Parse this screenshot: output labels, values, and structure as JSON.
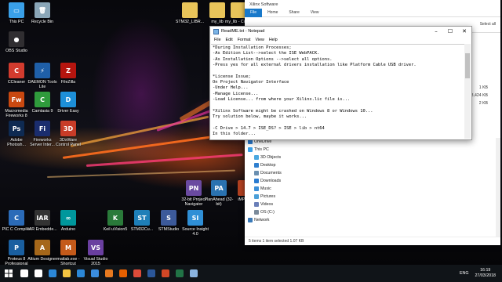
{
  "desktop_icons": [
    {
      "label": "This PC",
      "icon": "this-pc-icon",
      "color": "#3aa0e8",
      "glyph": "▭"
    },
    {
      "label": "Recycle Bin",
      "icon": "recycle-bin-icon",
      "color": "#8aa6b8",
      "glyph": "🗑"
    },
    {
      "label": "OBS Studio",
      "icon": "obs-studio-icon",
      "color": "#302e31",
      "glyph": "●"
    },
    {
      "label": "CCleaner",
      "icon": "ccleaner-icon",
      "color": "#d23b2e",
      "glyph": "C"
    },
    {
      "label": "DAEMON Tools Lite",
      "icon": "daemon-tools-icon",
      "color": "#1f5fa8",
      "glyph": "⚡"
    },
    {
      "label": "FileZilla",
      "icon": "filezilla-icon",
      "color": "#b5150f",
      "glyph": "Z"
    },
    {
      "label": "Macromedia Fireworks 8",
      "icon": "fireworks-icon",
      "color": "#c94810",
      "glyph": "Fw"
    },
    {
      "label": "Camtasia 9",
      "icon": "camtasia-icon",
      "color": "#2f9b3c",
      "glyph": "C"
    },
    {
      "label": "Driver Easy",
      "icon": "driver-easy-icon",
      "color": "#1d8fd8",
      "glyph": "D"
    },
    {
      "label": "Adobe Photosh...",
      "icon": "photoshop-icon",
      "color": "#0e2a52",
      "glyph": "Ps"
    },
    {
      "label": "Fireworks Server Inter...",
      "icon": "fireworks-server-icon",
      "color": "#1a2d6e",
      "glyph": "Fi"
    },
    {
      "label": "3DxWare Control Panel",
      "icon": "3dxware-icon",
      "color": "#c83c28",
      "glyph": "3D"
    },
    {
      "label": "PIC C Compiler",
      "icon": "pic-c-compiler-icon",
      "color": "#2b6bb8",
      "glyph": "C"
    },
    {
      "label": "IAR Embedde...",
      "icon": "iar-embedded-icon",
      "color": "#333333",
      "glyph": "IAR"
    },
    {
      "label": "Arduino",
      "icon": "arduino-icon",
      "color": "#00979c",
      "glyph": "∞"
    },
    {
      "label": "Keil uVision5",
      "icon": "keil-uvision-icon",
      "color": "#2a7a3a",
      "glyph": "K"
    },
    {
      "label": "STM32Cu...",
      "icon": "stm32cube-icon",
      "color": "#1e7fb8",
      "glyph": "ST"
    },
    {
      "label": "STMStudio",
      "icon": "stmstudio-icon",
      "color": "#3c5a9a",
      "glyph": "S"
    },
    {
      "label": "Source Insight 4.0",
      "icon": "source-insight-icon",
      "color": "#2f8fd6",
      "glyph": "SI"
    },
    {
      "label": "32-bit Project Navigator",
      "icon": "project-navigator-icon",
      "color": "#6a4aa0",
      "glyph": "PN"
    },
    {
      "label": "PlanAhead (32-bit)",
      "icon": "planahead-icon",
      "color": "#2a72b0",
      "glyph": "PA"
    },
    {
      "label": "iMPACT",
      "icon": "impact-icon",
      "color": "#b04020",
      "glyph": "i"
    },
    {
      "label": "Proteus 8 Professional",
      "icon": "proteus-icon",
      "color": "#1a5fa0",
      "glyph": "P"
    },
    {
      "label": "Altium Designer",
      "icon": "altium-icon",
      "color": "#a5671a",
      "glyph": "A"
    },
    {
      "label": "matlab.exe - Shortcut",
      "icon": "matlab-icon",
      "color": "#c45a1a",
      "glyph": "M"
    },
    {
      "label": "Visual Studio 2015",
      "icon": "visual-studio-icon",
      "color": "#6a3fa0",
      "glyph": "VS"
    },
    {
      "label": "STM32_LIBR...",
      "icon": "folder-icon",
      "color": "#e8c45a",
      "glyph": ""
    },
    {
      "label": "my_lib",
      "icon": "folder-icon",
      "color": "#e8c45a",
      "glyph": ""
    },
    {
      "label": "my_lib - Cop...",
      "icon": "folder-icon",
      "color": "#e8c45a",
      "glyph": ""
    }
  ],
  "notepad": {
    "title": "ReadME.txt - Notepad",
    "menu": [
      "File",
      "Edit",
      "Format",
      "View",
      "Help"
    ],
    "controls": [
      "–",
      "☐",
      "✕"
    ],
    "content": "*During Installation Processes;\n-As Edition List-->select the ISE WebPACK.\n-As Installation Options -->select all options.\n-Press yes for all external drivers installation like Platform Cable USB driver.\n\n*License Issue;\nOn Project Navigator Interface\n-Under Help...\n-Manage License...\n-Load License... from where your Xilinx.lic file is...\n\n*Xilinx Software might be crashed on Windows 8 or Windows 10...\nTry solution below, maybe it works...\n\n-C Drive > 14.7 > ISE_DS? > ISE > lib > nt64\nIn this folder..."
  },
  "explorer": {
    "title": "Xilinx Software",
    "tabs": [
      "File",
      "Home",
      "Share",
      "View"
    ],
    "select_all": "Select all",
    "sizes": [
      "1 KB",
      "3,424 KB",
      "2 KB"
    ],
    "nav": [
      {
        "label": "OneDrive",
        "sub": false,
        "color": "#2b7cd3"
      },
      {
        "label": "This PC",
        "sub": false,
        "color": "#3aa0e8"
      },
      {
        "label": "3D Objects",
        "sub": true,
        "color": "#4aa8e0"
      },
      {
        "label": "Desktop",
        "sub": true,
        "color": "#2f7fcf"
      },
      {
        "label": "Documents",
        "sub": true,
        "color": "#6a8fb0"
      },
      {
        "label": "Downloads",
        "sub": true,
        "color": "#2a7bd0"
      },
      {
        "label": "Music",
        "sub": true,
        "color": "#3b8fd8"
      },
      {
        "label": "Pictures",
        "sub": true,
        "color": "#4a9fd8"
      },
      {
        "label": "Videos",
        "sub": true,
        "color": "#6a7fb8"
      },
      {
        "label": "OS (C:)",
        "sub": true,
        "color": "#7a8a9a"
      },
      {
        "label": "Network",
        "sub": false,
        "color": "#3a7ab8"
      }
    ],
    "status": "5 items    1 item selected  1.07 KB"
  },
  "taskbar": {
    "apps": [
      {
        "name": "search-icon",
        "color": "#ffffff"
      },
      {
        "name": "task-view-icon",
        "color": "#ffffff"
      },
      {
        "name": "edge-icon",
        "color": "#2b88d8"
      },
      {
        "name": "file-explorer-icon",
        "color": "#f4c542"
      },
      {
        "name": "store-icon",
        "color": "#2b88d8"
      },
      {
        "name": "mail-icon",
        "color": "#3a8de0"
      },
      {
        "name": "media-player-icon",
        "color": "#e87a20"
      },
      {
        "name": "firefox-icon",
        "color": "#e66000"
      },
      {
        "name": "chrome-icon",
        "color": "#dd4b39"
      },
      {
        "name": "word-icon",
        "color": "#2b579a"
      },
      {
        "name": "powerpoint-icon",
        "color": "#d24726"
      },
      {
        "name": "excel-icon",
        "color": "#217346"
      },
      {
        "name": "notepad-icon",
        "color": "#8ab4e0"
      }
    ],
    "lang": "ENG",
    "time": "16:19",
    "date": "27/03/2018"
  }
}
